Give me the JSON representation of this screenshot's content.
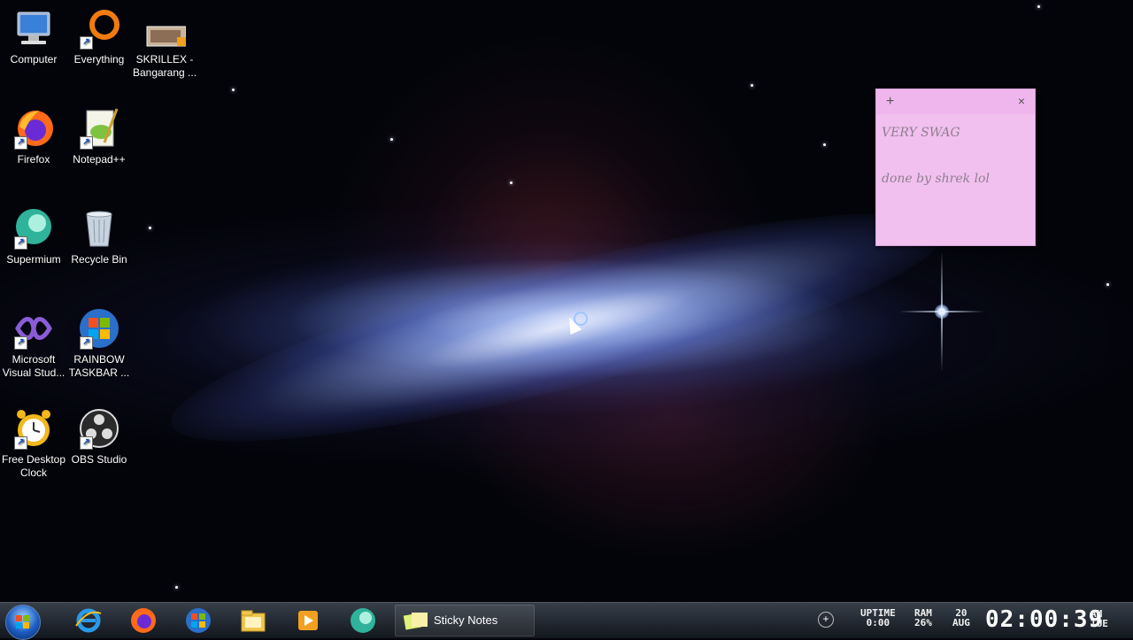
{
  "desktop": {
    "icons": [
      {
        "label": "Computer",
        "icon": "computer-icon"
      },
      {
        "label": "Everything",
        "icon": "everything-icon"
      },
      {
        "label": "SKRILLEX - Bangarang ...",
        "icon": "video-file-icon"
      },
      {
        "label": "Firefox",
        "icon": "firefox-icon"
      },
      {
        "label": "Notepad++",
        "icon": "notepadpp-icon"
      },
      {
        "label": "Supermium",
        "icon": "supermium-icon"
      },
      {
        "label": "Recycle Bin",
        "icon": "recycle-bin-icon"
      },
      {
        "label": "Microsoft Visual Stud...",
        "icon": "visual-studio-icon"
      },
      {
        "label": "RAINBOW TASKBAR ...",
        "icon": "windows-flag-icon"
      },
      {
        "label": "Free Desktop Clock",
        "icon": "alarm-clock-icon"
      },
      {
        "label": "OBS Studio",
        "icon": "obs-icon"
      }
    ]
  },
  "sticky_note": {
    "add_glyph": "+",
    "close_glyph": "×",
    "line1": "VERY SWAG",
    "line2": "done by shrek lol",
    "color": "#f1c0ef"
  },
  "taskbar": {
    "pinned": [
      {
        "icon": "internet-explorer-icon"
      },
      {
        "icon": "firefox-icon"
      },
      {
        "icon": "windows-flag-icon"
      },
      {
        "icon": "file-explorer-icon"
      },
      {
        "icon": "media-player-icon"
      },
      {
        "icon": "supermium-icon"
      }
    ],
    "active_window": {
      "label": "Sticky Notes",
      "icon": "sticky-notes-icon"
    },
    "tray": {
      "uptime_label": "UPTIME",
      "uptime_value": "0:00",
      "ram_label": "RAM",
      "ram_value": "26%",
      "date_day": "20",
      "date_month": "AUG",
      "time": "02:00:39",
      "ampm": "AM",
      "weekday": "TUE"
    }
  }
}
